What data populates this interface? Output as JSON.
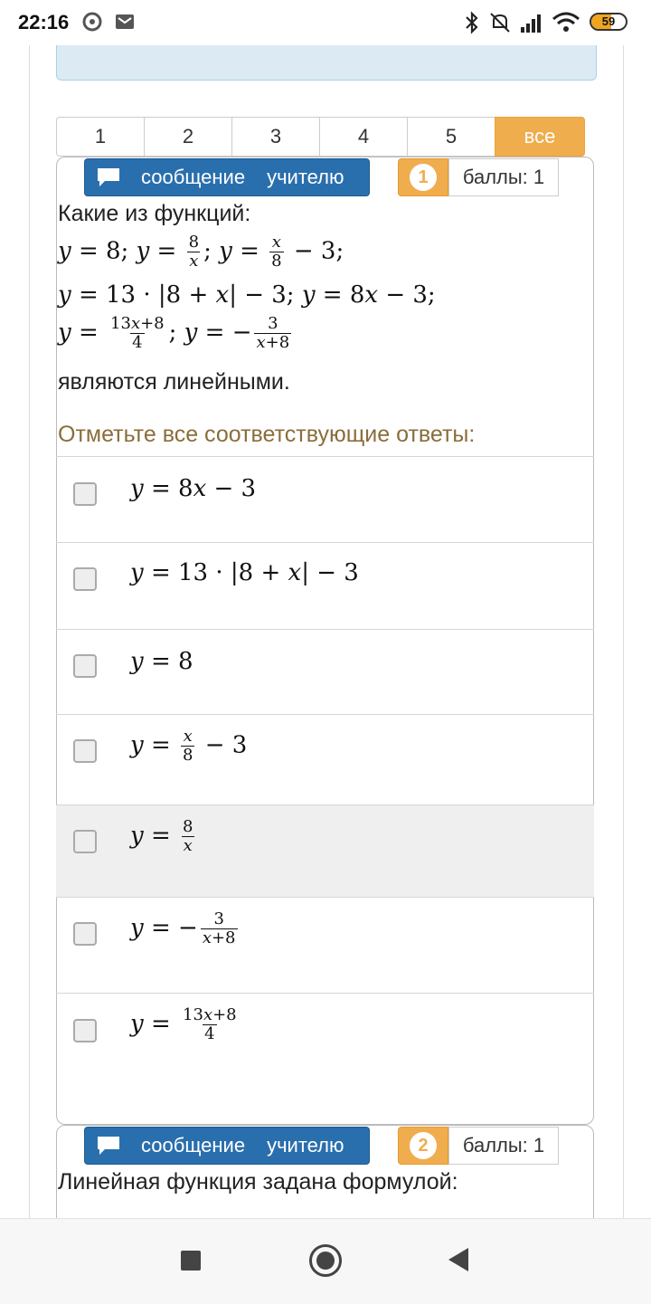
{
  "status": {
    "time": "22:16",
    "battery": "59",
    "battery_level": 0.59
  },
  "pager": {
    "items": [
      "1",
      "2",
      "3",
      "4",
      "5",
      "все"
    ],
    "active_index": 5
  },
  "question1": {
    "message_words": [
      "сообщение",
      "учителю"
    ],
    "number": "1",
    "points": "баллы: 1",
    "title": "Какие из функций:",
    "ending": "являются линейными.",
    "prompt": "Отметьте все соответствующие ответы:"
  },
  "answers": [
    "y = 8x − 3",
    "y = 13 · |8 + x| − 3",
    "y = 8",
    "y = x/8 − 3",
    "y = 8/x",
    "y = −3/(x+8)",
    "y = (13x+8)/4"
  ],
  "question2": {
    "message_words": [
      "сообщение",
      "учителю"
    ],
    "number": "2",
    "points": "баллы: 1",
    "title": "Линейная функция задана формулой:"
  },
  "colors": {
    "accent": "#f0ad4e",
    "button_blue": "#2a6fad",
    "prompt": "#8a6d3b"
  }
}
